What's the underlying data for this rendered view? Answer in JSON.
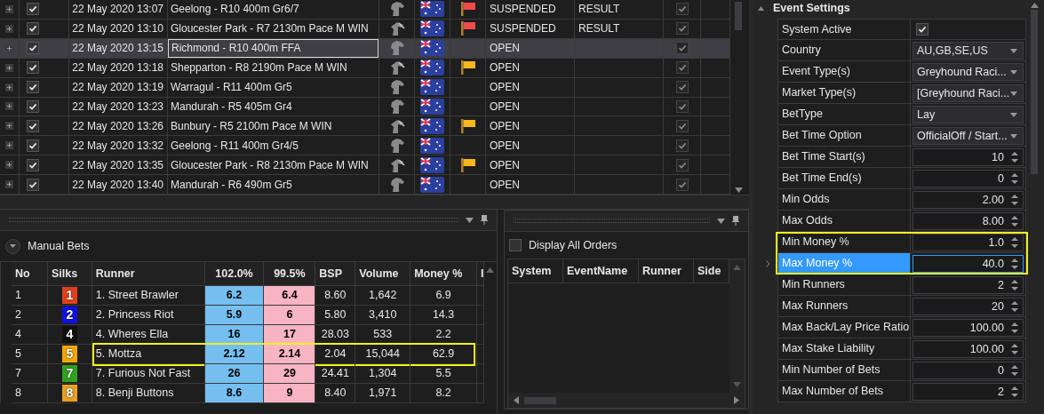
{
  "events": {
    "rows": [
      {
        "checked": true,
        "date": "22 May 2020 13:07",
        "name": "Geelong - R10 400m Gr6/7",
        "kind": "greyhound",
        "color": "#ec4b4b",
        "status": "SUSPENDED",
        "result": "RESULT",
        "settled": true,
        "selected": false
      },
      {
        "checked": true,
        "date": "22 May 2020 13:10",
        "name": "Gloucester Park - R7 2130m Pace M WIN",
        "kind": "harness",
        "color": "#ec4b4b",
        "status": "SUSPENDED",
        "result": "RESULT",
        "settled": true,
        "selected": false
      },
      {
        "checked": true,
        "date": "22 May 2020 13:15",
        "name": "Richmond - R10 400m FFA",
        "kind": "greyhound",
        "status": "OPEN",
        "settled": true,
        "selected": true
      },
      {
        "checked": true,
        "date": "22 May 2020 13:18",
        "name": "Shepparton - R8 2190m Pace M WIN",
        "kind": "harness",
        "color": "#f6b81c",
        "status": "OPEN",
        "settled": true,
        "selected": false
      },
      {
        "checked": true,
        "date": "22 May 2020 13:19",
        "name": "Warragul - R11 400m Gr5",
        "kind": "greyhound",
        "status": "OPEN",
        "settled": true,
        "selected": false
      },
      {
        "checked": true,
        "date": "22 May 2020 13:23",
        "name": "Mandurah - R5 405m Gr4",
        "kind": "greyhound",
        "status": "OPEN",
        "settled": true,
        "selected": false
      },
      {
        "checked": true,
        "date": "22 May 2020 13:26",
        "name": "Bunbury - R5 2100m Pace M WIN",
        "kind": "harness",
        "color": "#f6b81c",
        "status": "OPEN",
        "settled": true,
        "selected": false
      },
      {
        "checked": true,
        "date": "22 May 2020 13:32",
        "name": "Geelong - R11 400m Gr4/5",
        "kind": "greyhound",
        "status": "OPEN",
        "settled": true,
        "selected": false
      },
      {
        "checked": true,
        "date": "22 May 2020 13:35",
        "name": "Gloucester Park - R8 2130m Pace M WIN",
        "kind": "harness",
        "color": "#f6b81c",
        "status": "OPEN",
        "settled": true,
        "selected": false
      },
      {
        "checked": true,
        "date": "22 May 2020 13:40",
        "name": "Mandurah - R6 490m Gr5",
        "kind": "greyhound",
        "status": "OPEN",
        "settled": true,
        "selected": false
      }
    ]
  },
  "manual_bets": {
    "title": "Manual Bets",
    "columns": [
      "No",
      "Silks",
      "Runner",
      "102.0%",
      "99.5%",
      "BSP",
      "Volume",
      "Money %",
      "I"
    ],
    "rows": [
      {
        "no": "1",
        "silk_number": "1",
        "color": "#e0401c",
        "runner": "1. Street Brawler",
        "back": "6.2",
        "lay": "6.4",
        "bsp": "8.60",
        "volume": "1,642",
        "money": "6.9",
        "highlighted": false
      },
      {
        "no": "2",
        "silk_number": "2",
        "color": "#1010e0",
        "runner": "2. Princess Riot",
        "back": "5.9",
        "lay": "6",
        "bsp": "5.80",
        "volume": "3,410",
        "money": "14.3",
        "highlighted": false
      },
      {
        "no": "4",
        "silk_number": "4",
        "color": "#101010",
        "runner": "4. Wheres Ella",
        "back": "16",
        "lay": "17",
        "bsp": "28.03",
        "volume": "533",
        "money": "2.2",
        "highlighted": false
      },
      {
        "no": "5",
        "silk_number": "5",
        "color": "#f0a800",
        "runner": "5. Mottza",
        "back": "2.12",
        "lay": "2.14",
        "bsp": "2.04",
        "volume": "15,044",
        "money": "62.9",
        "highlighted": true
      },
      {
        "no": "7",
        "silk_number": "7",
        "color": "#30a020",
        "runner": "7. Furious Not Fast",
        "back": "26",
        "lay": "29",
        "bsp": "24.41",
        "volume": "1,304",
        "money": "5.5",
        "highlighted": false
      },
      {
        "no": "8",
        "silk_number": "8",
        "color": "#e8a020",
        "runner": "8. Benji Buttons",
        "back": "8.6",
        "lay": "9",
        "bsp": "8.40",
        "volume": "1,971",
        "money": "8.2",
        "highlighted": false
      }
    ]
  },
  "orders": {
    "display_all_orders": {
      "label": "Display All Orders",
      "checked": false
    },
    "columns": [
      "System",
      "EventName",
      "Runner",
      "Side"
    ]
  },
  "settings": {
    "title": "Event Settings",
    "expanded": true,
    "items": [
      {
        "kind": "checkbox",
        "label": "System Active",
        "checked": true,
        "selected": false,
        "highlighted": false
      },
      {
        "kind": "dropdown",
        "label": "Country",
        "value": "AU,GB,SE,US",
        "selected": false,
        "highlighted": false
      },
      {
        "kind": "dropdown",
        "label": "Event Type(s)",
        "value": "Greyhound Raci...",
        "selected": false,
        "highlighted": false
      },
      {
        "kind": "dropdown",
        "label": "Market Type(s)",
        "value": "[Greyhound Raci...",
        "selected": false,
        "highlighted": false
      },
      {
        "kind": "dropdown",
        "label": "BetType",
        "value": "Lay",
        "selected": false,
        "highlighted": false
      },
      {
        "kind": "dropdown",
        "label": "Bet Time Option",
        "value": "OfficialOff / Start...",
        "selected": false,
        "highlighted": false
      },
      {
        "kind": "spinner",
        "label": "Bet Time Start(s)",
        "value": "10",
        "selected": false,
        "highlighted": false
      },
      {
        "kind": "spinner",
        "label": "Bet Time End(s)",
        "value": "0",
        "selected": false,
        "highlighted": false
      },
      {
        "kind": "spinner",
        "label": "Min Odds",
        "value": "2.00",
        "selected": false,
        "highlighted": false
      },
      {
        "kind": "spinner",
        "label": "Max Odds",
        "value": "8.00",
        "selected": false,
        "highlighted": false
      },
      {
        "kind": "spinner",
        "label": "Min Money %",
        "value": "1.0",
        "selected": false,
        "highlighted": true
      },
      {
        "kind": "spinner",
        "label": "Max Money %",
        "value": "40.0",
        "selected": true,
        "highlighted": true
      },
      {
        "kind": "spinner",
        "label": "Min Runners",
        "value": "2",
        "selected": false,
        "highlighted": false
      },
      {
        "kind": "spinner",
        "label": "Max Runners",
        "value": "20",
        "selected": false,
        "highlighted": false
      },
      {
        "kind": "spinner",
        "label": "Max Back/Lay Price Ratio",
        "value": "100.00",
        "selected": false,
        "highlighted": false
      },
      {
        "kind": "spinner",
        "label": "Max Stake Liability",
        "value": "100.00",
        "selected": false,
        "highlighted": false
      },
      {
        "kind": "spinner",
        "label": "Min Number of Bets",
        "value": "0",
        "selected": false,
        "highlighted": false
      },
      {
        "kind": "spinner",
        "label": "Max Number of Bets",
        "value": "2",
        "selected": false,
        "highlighted": false
      }
    ]
  }
}
